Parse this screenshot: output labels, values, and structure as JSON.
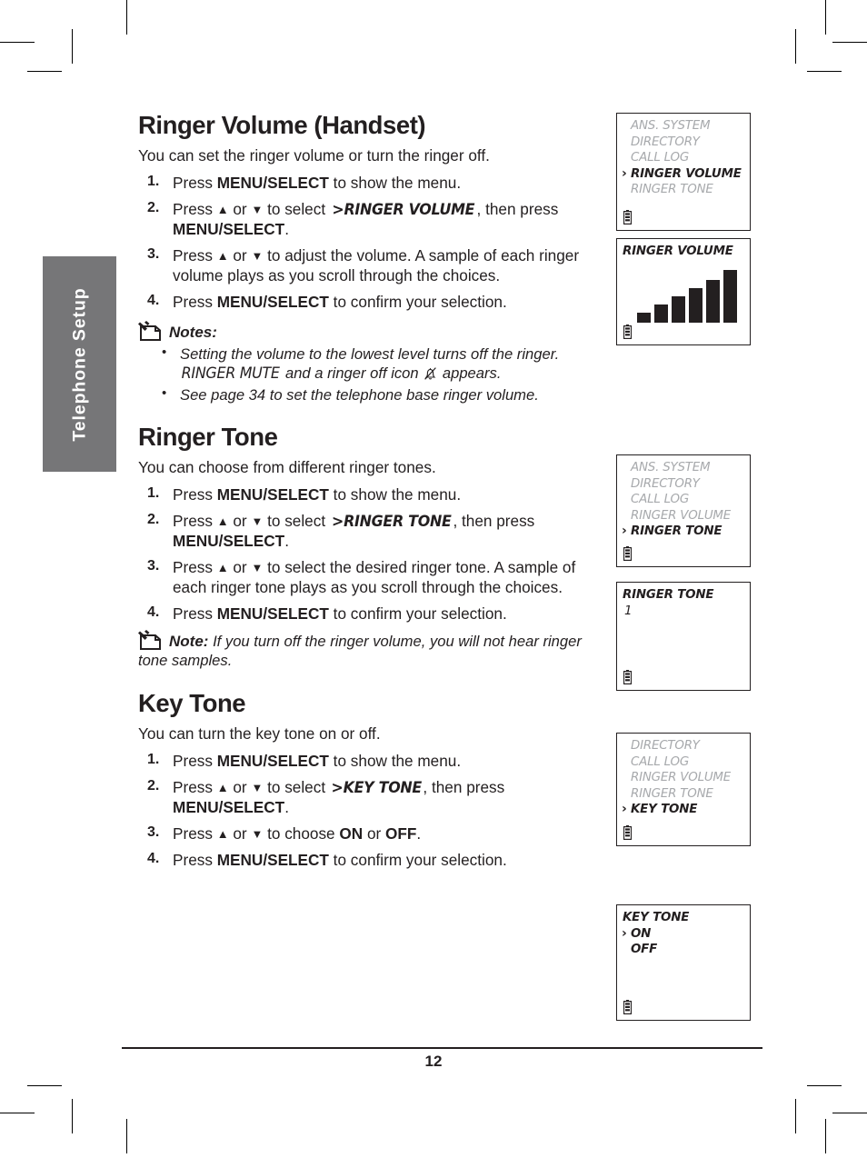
{
  "page": {
    "number": "12",
    "side_tab_label": "Telephone Setup"
  },
  "sections": [
    {
      "title": "Ringer Volume (Handset)",
      "intro": "You can set the ringer volume or turn the ringer off.",
      "steps": [
        {
          "num": "1.",
          "pre": "Press ",
          "bold1": "MENU/SELECT",
          "post": " to show the menu."
        },
        {
          "num": "2.",
          "pre": "Press ",
          "arrow_up": "▲",
          "mid": " or ",
          "arrow_down": "▼",
          "mid2": " to select ",
          "lcd": ">RINGER VOLUME",
          "post": ", then press ",
          "bold2": "MENU/SELECT",
          "end": "."
        },
        {
          "num": "3.",
          "pre": "Press ",
          "arrow_up": "▲",
          "mid": " or ",
          "arrow_down": "▼",
          "mid2": " to adjust the volume. A sample of each ringer volume plays as you scroll through the choices."
        },
        {
          "num": "4.",
          "pre": "Press ",
          "bold1": "MENU/SELECT",
          "post": " to confirm your selection."
        }
      ],
      "notes": {
        "heading": "Notes:",
        "items": [
          {
            "pre": "Setting the volume to the lowest level turns off the ringer. ",
            "lcd": "RINGER MUTE",
            "post": " and a ringer off icon ",
            "icon": "ringer-off-icon",
            "end": " appears."
          },
          {
            "pre": "See page 34 to set the telephone base ringer volume."
          }
        ]
      }
    },
    {
      "title": "Ringer Tone",
      "intro": "You can choose from different ringer tones.",
      "steps": [
        {
          "num": "1.",
          "pre": "Press ",
          "bold1": "MENU/SELECT",
          "post": " to show the menu."
        },
        {
          "num": "2.",
          "pre": "Press ",
          "arrow_up": "▲",
          "mid": " or ",
          "arrow_down": "▼",
          "mid2": " to select ",
          "lcd": ">RINGER TONE",
          "post": ", then press ",
          "bold2": "MENU/SELECT",
          "end": "."
        },
        {
          "num": "3.",
          "pre": "Press ",
          "arrow_up": "▲",
          "mid": " or ",
          "arrow_down": "▼",
          "mid2": " to select the desired ringer tone. A sample of each ringer tone plays as you scroll through the choices."
        },
        {
          "num": "4.",
          "pre": "Press ",
          "bold1": "MENU/SELECT",
          "post": " to confirm your selection."
        }
      ],
      "note": {
        "heading": "Note:",
        "text": " If you turn off the ringer volume, you will not hear ringer tone samples."
      }
    },
    {
      "title": "Key Tone",
      "intro": "You can turn the key tone on or off.",
      "steps": [
        {
          "num": "1.",
          "pre": "Press ",
          "bold1": "MENU/SELECT",
          "post": " to show the menu."
        },
        {
          "num": "2.",
          "pre": "Press ",
          "arrow_up": "▲",
          "mid": " or ",
          "arrow_down": "▼",
          "mid2": " to select ",
          "lcd": ">KEY TONE",
          "post": ", then press ",
          "bold2": "MENU/SELECT",
          "end": "."
        },
        {
          "num": "3.",
          "pre": "Press ",
          "arrow_up": "▲",
          "mid": " or ",
          "arrow_down": "▼",
          "mid2": " to choose ",
          "bold1": "ON",
          "post": " or ",
          "bold2": "OFF",
          "end": "."
        },
        {
          "num": "4.",
          "pre": "Press ",
          "bold1": "MENU/SELECT",
          "post": " to confirm your selection."
        }
      ]
    }
  ],
  "lcd_screens": [
    {
      "id": "menu-ringer-volume",
      "kind": "menu",
      "rows": [
        {
          "text": "ANS. SYSTEM",
          "selected": false
        },
        {
          "text": "DIRECTORY",
          "selected": false
        },
        {
          "text": "CALL LOG",
          "selected": false
        },
        {
          "text": "RINGER VOLUME",
          "selected": true
        },
        {
          "text": "RINGER TONE",
          "selected": false
        }
      ],
      "battery": true
    },
    {
      "id": "ringer-volume-level",
      "kind": "volume",
      "title": "RINGER VOLUME",
      "bars": [
        11,
        20,
        29,
        38,
        47,
        58
      ],
      "battery": true
    },
    {
      "id": "menu-ringer-tone",
      "kind": "menu",
      "rows": [
        {
          "text": "ANS. SYSTEM",
          "selected": false
        },
        {
          "text": "DIRECTORY",
          "selected": false
        },
        {
          "text": "CALL LOG",
          "selected": false
        },
        {
          "text": "RINGER VOLUME",
          "selected": false
        },
        {
          "text": "RINGER TONE",
          "selected": true
        }
      ],
      "battery": true
    },
    {
      "id": "ringer-tone-value",
      "kind": "value",
      "title": "RINGER TONE",
      "value": "1",
      "battery": true
    },
    {
      "id": "menu-key-tone",
      "kind": "menu",
      "rows": [
        {
          "text": "DIRECTORY",
          "selected": false
        },
        {
          "text": "CALL LOG",
          "selected": false
        },
        {
          "text": "RINGER VOLUME",
          "selected": false
        },
        {
          "text": "RINGER TONE",
          "selected": false
        },
        {
          "text": "KEY TONE",
          "selected": true
        }
      ],
      "battery": true
    },
    {
      "id": "key-tone-options",
      "kind": "options",
      "title": "KEY TONE",
      "options": [
        {
          "text": "ON",
          "selected": true
        },
        {
          "text": "OFF",
          "selected": false
        }
      ],
      "battery": true
    }
  ],
  "colors": {
    "ink": "#231f20",
    "lcd_dim": "#a7a9ac",
    "tab_gray": "#767678"
  }
}
